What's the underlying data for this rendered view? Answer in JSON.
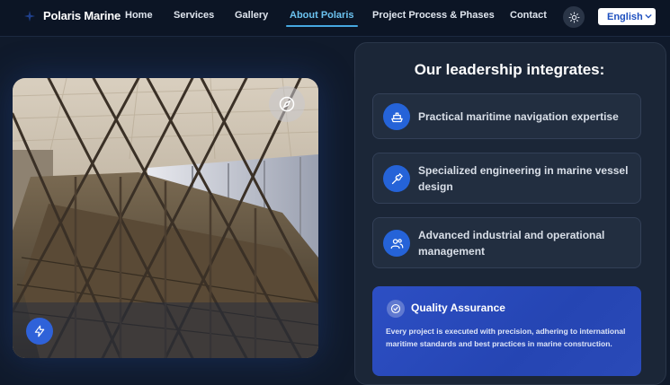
{
  "nav": {
    "brand": "Polaris Marine",
    "links": [
      "Home",
      "Services",
      "Gallery",
      "About Polaris",
      "Project Process & Phases",
      "Contact"
    ],
    "active_link": "About Polaris",
    "language": "English"
  },
  "icons": {
    "brand": "star-logo-icon",
    "theme": "sun-icon",
    "language_chevron": "chevron-down-icon",
    "hero_top_badge": "compass-icon",
    "hero_bottom_badge": "lightning-icon",
    "card1": "ship-icon",
    "card2": "wrench-icon",
    "card3": "users-icon",
    "qa": "check-circle-icon"
  },
  "leadership": {
    "title": "Our leadership integrates:",
    "items": [
      {
        "text": "Practical maritime navigation expertise"
      },
      {
        "text": "Specialized engineering in marine vessel design"
      },
      {
        "text": "Advanced industrial and operational management"
      }
    ]
  },
  "quality": {
    "title": "Quality Assurance",
    "description": "Every project is executed with precision, adhering to international maritime standards and best practices in marine construction."
  },
  "colors": {
    "background": "#101a2b",
    "accent": "#2563d8",
    "active_link": "#6cc3f0"
  }
}
